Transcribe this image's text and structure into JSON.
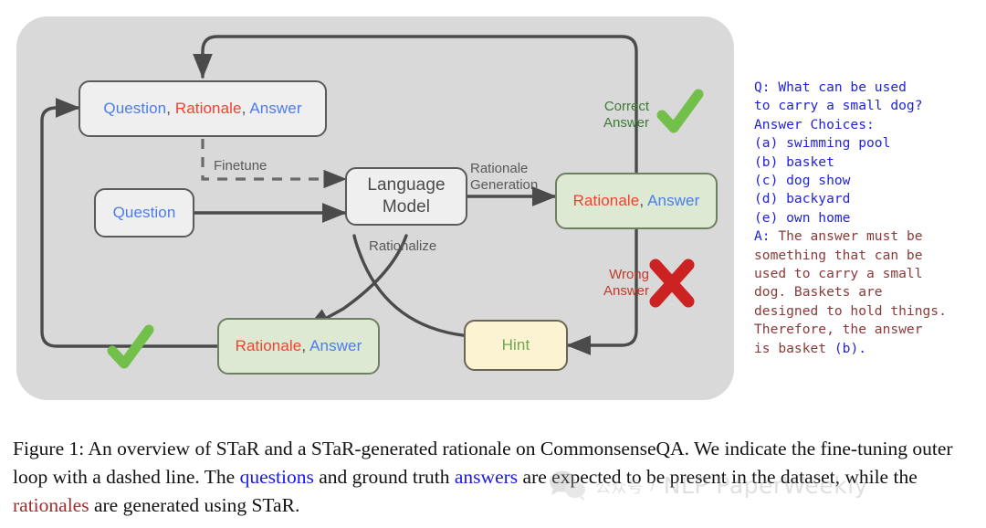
{
  "figure": {
    "nodes": {
      "qra_top": {
        "question": "Question",
        "sep1": ", ",
        "rationale": "Rationale",
        "sep2": ", ",
        "answer": "Answer"
      },
      "question": {
        "label": "Question"
      },
      "language_model": {
        "label": "Language\nModel"
      },
      "rationale_answer_right": {
        "rationale": "Rationale",
        "sep": ", ",
        "answer": "Answer"
      },
      "rationale_answer_bottom": {
        "rationale": "Rationale",
        "sep": ", ",
        "answer": "Answer"
      },
      "hint": {
        "label": "Hint"
      }
    },
    "edge_labels": {
      "finetune": "Finetune",
      "rationale_generation": "Rationale\nGeneration",
      "rationalize": "Rationalize",
      "correct_answer": "Correct\nAnswer",
      "wrong_answer": "Wrong\nAnswer"
    },
    "icons": {
      "correct_check_right": "check-mark-icon",
      "correct_check_bottom": "check-mark-icon",
      "wrong_cross": "cross-mark-icon"
    },
    "colors": {
      "panel_bg": "#d9d9d9",
      "box_grey": "#efefef",
      "box_green": "#dde9d2",
      "box_cream": "#fcf3d3",
      "stroke": "#5a5a5a",
      "blue_text": "#4a7dea",
      "red_text": "#f5402c",
      "green_text": "#6aa84f",
      "correct_green": "#3c7a36",
      "wrong_red": "#c0392b",
      "check_green": "#72c04a",
      "cross_red": "#cc2222"
    }
  },
  "qa_panel": {
    "lines": [
      {
        "text": "Q: ",
        "color": "blue"
      },
      {
        "text": "What can be used\nto carry a small dog?\nAnswer Choices:\n(a) swimming pool\n(b) basket\n(c) dog show\n(d) backyard\n(e) own home\n",
        "color": "blue"
      },
      {
        "text": "A: ",
        "color": "blue"
      },
      {
        "text": "The answer must be\nsomething that can be\nused to carry a small\ndog. Baskets are\ndesigned to hold things.\nTherefore, the answer\nis basket ",
        "color": "dark"
      },
      {
        "text": "(b).",
        "color": "blue"
      }
    ],
    "full_text": "Q: What can be used to carry a small dog? Answer Choices: (a) swimming pool (b) basket (c) dog show (d) backyard (e) own home A: The answer must be something that can be used to carry a small dog. Baskets are designed to hold things. Therefore, the answer is basket (b)."
  },
  "caption": {
    "part1": "Figure 1: An overview of STaR and a STaR-generated rationale on CommonsenseQA. We indicate the fine-tuning outer loop with a dashed line. The ",
    "questions": "questions",
    "part2": " and ground truth ",
    "answers": "answers",
    "part3": " are expected to be present in the dataset, while the ",
    "rationales": "rationales",
    "part4": " are generated using STaR."
  },
  "watermark": {
    "cn": "公众号",
    "divider": "/",
    "en": "NLP PaperWeekly"
  }
}
